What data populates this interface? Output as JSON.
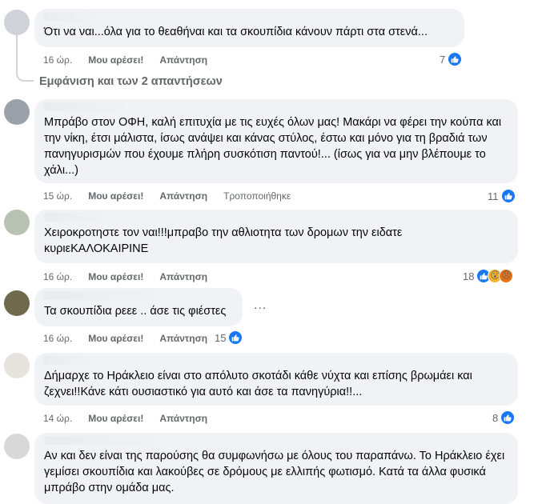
{
  "comments": [
    {
      "text": "Ότι να ναι...όλα για το θεαθήναι και τα σκουπίδια κάνουν πάρτι στα στενά...",
      "time": "16 ώρ.",
      "like": "Μου αρέσει!",
      "reply": "Απάντηση",
      "edited": "",
      "count": "7",
      "reactions": [
        "like-icon"
      ]
    },
    {
      "text": "Μπράβο στον ΟΦΗ, καλή επιτυχία με τις ευχές όλων μας! Μακάρι να φέρει την κούπα και την νίκη, έτσι μάλιστα, ίσως ανάψει και κάνας στύλος, έστω και μόνο για τη βραδιά των πανηγυρισμών που έχουμε πλήρη συσκότιση παντού!... (ίσως για να μην βλέπουμε το χάλι...)",
      "time": "15 ώρ.",
      "like": "Μου αρέσει!",
      "reply": "Απάντηση",
      "edited": "Τροποποιήθηκε",
      "count": "11",
      "reactions": [
        "like-icon"
      ]
    },
    {
      "text": "Χειροκροτηστε τον ναι!!!μπραβο την αθλιοτητα των δρομων την ειδατε κυριεΚΑΛΟΚΑΙΡΙΝΕ",
      "time": "16 ώρ.",
      "like": "Μου αρέσει!",
      "reply": "Απάντηση",
      "edited": "",
      "count": "18",
      "reactions": [
        "like-icon",
        "wow-icon",
        "angry-icon"
      ]
    },
    {
      "text": "Τα σκουπίδια ρεεε .. άσε τις φιέστες",
      "time": "16 ώρ.",
      "like": "Μου αρέσει!",
      "reply": "Απάντηση",
      "edited": "",
      "count": "15",
      "reactions": [
        "like-icon"
      ]
    },
    {
      "text": "Δήμαρχε το Ηράκλειο είναι στο απόλυτο σκοτάδι κάθε νύχτα και επίσης βρωμάει και ζεχνει!!Κάνε κάτι ουσιαστικό για αυτό και άσε τα πανηγύρια!!...",
      "time": "14 ώρ.",
      "like": "Μου αρέσει!",
      "reply": "Απάντηση",
      "edited": "",
      "count": "8",
      "reactions": [
        "like-icon"
      ]
    },
    {
      "text": "Αν και δεν είναι της παρούσης θα συμφωνήσω με όλους του παραπάνω. Το Ηράκλειο έχει γεμίσει σκουπίδια και λακούβες σε δρόμους με ελλιπής φωτισμό. Κατά τα άλλα φυσικά μπράβο στην ομάδα μας.",
      "time": "",
      "like": "",
      "reply": "",
      "edited": "",
      "count": "",
      "reactions": []
    }
  ],
  "replies_link": "Εμφάνιση και των 2 απαντήσεων",
  "more_menu": "...",
  "colors": {
    "bubble": "#f0f2f5",
    "meta": "#65676b",
    "like": "#1877f2"
  }
}
